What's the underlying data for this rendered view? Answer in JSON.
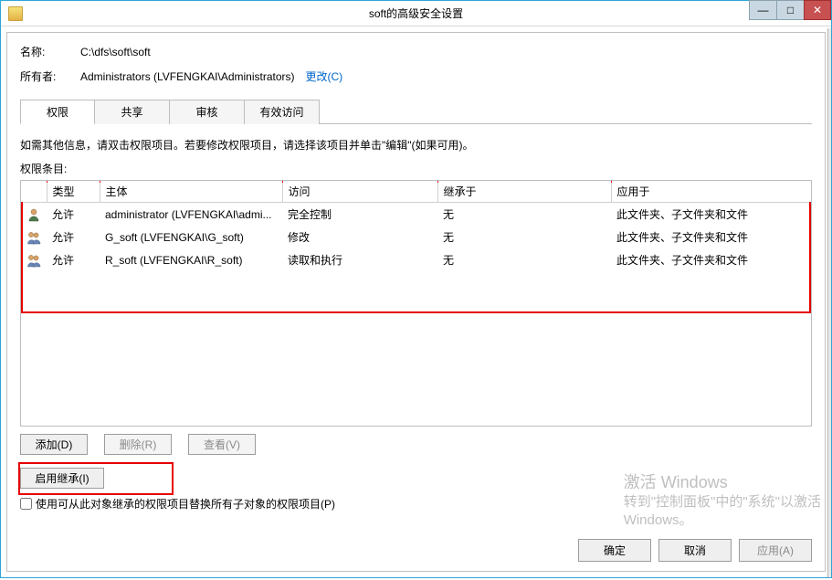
{
  "window": {
    "title": "soft的高级安全设置"
  },
  "header": {
    "name_label": "名称:",
    "name_value": "C:\\dfs\\soft\\soft",
    "owner_label": "所有者:",
    "owner_value": "Administrators (LVFENGKAI\\Administrators)",
    "change_link": "更改(C)"
  },
  "tabs": {
    "permissions": "权限",
    "share": "共享",
    "audit": "审核",
    "effective": "有效访问"
  },
  "instructions": "如需其他信息，请双击权限项目。若要修改权限项目，请选择该项目并单击\"编辑\"(如果可用)。",
  "section_label": "权限条目:",
  "columns": {
    "type": "类型",
    "principal": "主体",
    "access": "访问",
    "inherited_from": "继承于",
    "applies_to": "应用于"
  },
  "entries": [
    {
      "icon": "single",
      "type": "允许",
      "principal": "administrator (LVFENGKAI\\admi...",
      "access": "完全控制",
      "inherited_from": "无",
      "applies_to": "此文件夹、子文件夹和文件"
    },
    {
      "icon": "group",
      "type": "允许",
      "principal": "G_soft (LVFENGKAI\\G_soft)",
      "access": "修改",
      "inherited_from": "无",
      "applies_to": "此文件夹、子文件夹和文件"
    },
    {
      "icon": "group",
      "type": "允许",
      "principal": "R_soft (LVFENGKAI\\R_soft)",
      "access": "读取和执行",
      "inherited_from": "无",
      "applies_to": "此文件夹、子文件夹和文件"
    }
  ],
  "buttons": {
    "add": "添加(D)",
    "remove": "删除(R)",
    "view": "查看(V)",
    "enable_inherit": "启用继承(I)"
  },
  "checkbox": {
    "label": "使用可从此对象继承的权限项目替换所有子对象的权限项目(P)"
  },
  "dialog_buttons": {
    "ok": "确定",
    "cancel": "取消",
    "apply": "应用(A)"
  },
  "watermark": {
    "line1": "激活 Windows",
    "line2": "转到\"控制面板\"中的\"系统\"以激活",
    "line3": "Windows。"
  }
}
